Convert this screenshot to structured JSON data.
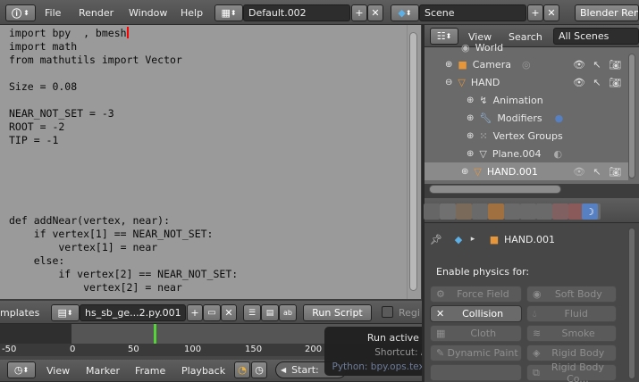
{
  "topbar": {
    "menus": [
      "File",
      "Render",
      "Window",
      "Help"
    ],
    "screen_layout": "Default.002",
    "scene": "Scene",
    "render_engine": "Blender Rend"
  },
  "text_editor": {
    "code_lines": [
      "import bpy  , bmesh",
      "import math",
      "from mathutils import Vector",
      "",
      "Size = 0.08",
      "",
      "NEAR_NOT_SET = -3",
      "ROOT = -2",
      "TIP = -1",
      "",
      "",
      "",
      "",
      "",
      "def addNear(vertex, near):",
      "    if vertex[1] == NEAR_NOT_SET:",
      "        vertex[1] = near",
      "    else:",
      "        if vertex[2] == NEAR_NOT_SET:",
      "            vertex[2] = near"
    ],
    "templates_label": "mplates",
    "file_name": "hs_sb_ge...2.py.001",
    "run_script_label": "Run Script",
    "register_label": "Regi"
  },
  "timeline": {
    "ruler_ticks": [
      "-50",
      "0",
      "50",
      "100",
      "150",
      "200"
    ],
    "current_frame": 70,
    "menus": [
      "View",
      "Marker",
      "Frame",
      "Playback"
    ],
    "start_label": "Start:"
  },
  "tooltip": {
    "title": "Run active script",
    "shortcut": "Shortcut: Alt P",
    "python": "Python: bpy.ops.text.run_script()"
  },
  "outliner": {
    "view_label": "View",
    "search_label": "Search",
    "filter_value": "All Scenes",
    "items": [
      {
        "label": "World",
        "indent": 1
      },
      {
        "label": "Camera",
        "indent": 1
      },
      {
        "label": "HAND",
        "indent": 1
      },
      {
        "label": "Animation",
        "indent": 2
      },
      {
        "label": "Modifiers",
        "indent": 2
      },
      {
        "label": "Vertex Groups",
        "indent": 2
      },
      {
        "label": "Plane.004",
        "indent": 2
      },
      {
        "label": "HAND.001",
        "indent": 1
      }
    ]
  },
  "properties": {
    "breadcrumb_object": "HAND.001",
    "enable_physics_label": "Enable physics for:",
    "physics_buttons": [
      {
        "label": "Force Field",
        "active": false
      },
      {
        "label": "Soft Body",
        "active": false
      },
      {
        "label": "Collision",
        "active": true
      },
      {
        "label": "Fluid",
        "active": false
      },
      {
        "label": "Cloth",
        "active": false
      },
      {
        "label": "Smoke",
        "active": false
      },
      {
        "label": "Dynamic Paint",
        "active": false
      },
      {
        "label": "Rigid Body",
        "active": false
      },
      {
        "label": "",
        "active": false
      },
      {
        "label": "Rigid Body Co...",
        "active": false
      }
    ]
  },
  "colors": {
    "accent_blue": "#5680c2",
    "cursor_red": "#ff0000",
    "frame_green": "#55d43a",
    "object_orange": "#e8963a"
  }
}
